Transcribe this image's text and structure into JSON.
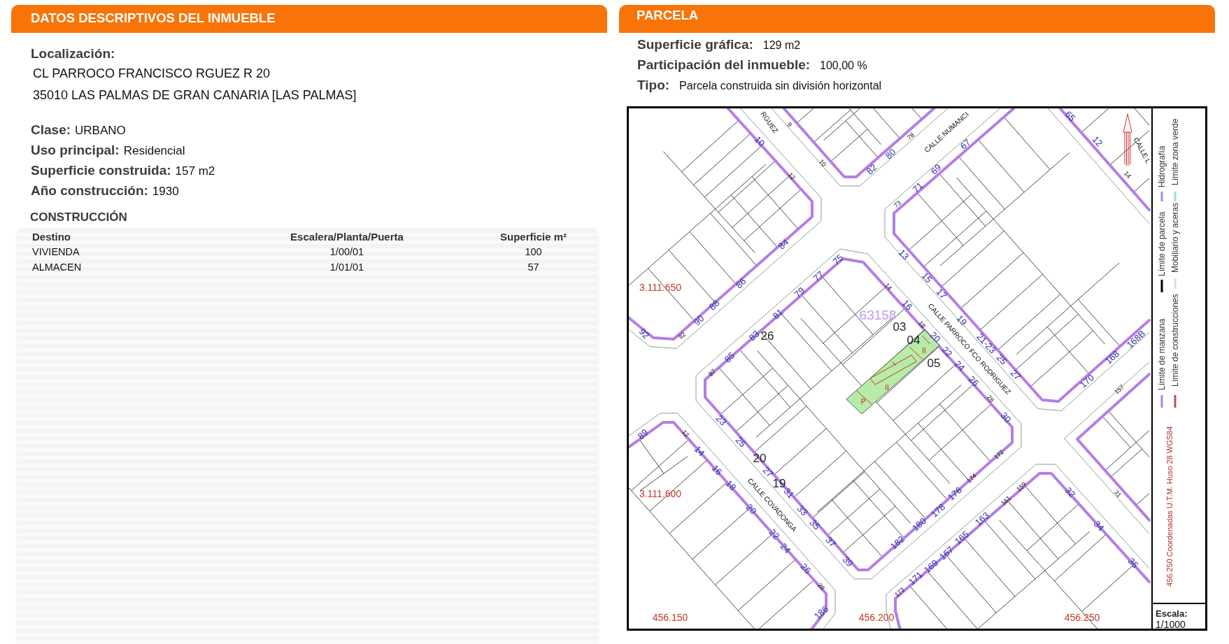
{
  "left": {
    "title": "DATOS DESCRIPTIVOS DEL INMUEBLE",
    "location": {
      "label": "Localización:",
      "lines": [
        "CL PARROCO FRANCISCO RGUEZ R 20",
        "35010 LAS PALMAS DE GRAN CANARIA [LAS PALMAS]"
      ]
    },
    "fields": [
      {
        "label": "Clase:",
        "value": "URBANO"
      },
      {
        "label": "Uso principal:",
        "value": "Residencial"
      },
      {
        "label": "Superficie construida:",
        "value": "157 m2"
      },
      {
        "label": "Año construcción:",
        "value": "1930"
      }
    ],
    "construction": {
      "title": "CONSTRUCCIÓN",
      "columns": [
        "Destino",
        "Escalera/Planta/Puerta",
        "Superficie m²"
      ],
      "rows": [
        [
          "VIVIENDA",
          "1/00/01",
          "100"
        ],
        [
          "ALMACEN",
          "1/01/01",
          "57"
        ]
      ]
    }
  },
  "parcel": {
    "title": "PARCELA",
    "fields": [
      {
        "label": "Superficie gráfica:",
        "value": "129 m2"
      },
      {
        "label": "Participación del inmueble:",
        "value": "100,00 %"
      },
      {
        "label": "Tipo:",
        "value": "Parcela construida sin división horizontal"
      }
    ],
    "map": {
      "labels": [
        {
          "text": "RGUEZ",
          "kind": "street"
        },
        {
          "text": "CALLE NUMANCI",
          "kind": "street"
        },
        {
          "text": "CALLE L",
          "kind": "street"
        },
        {
          "text": "CALLE PARROCO FCO RODRIGUEZ",
          "kind": "street"
        },
        {
          "text": "CALLE COVADONGA",
          "kind": "street"
        },
        {
          "text": "10",
          "kind": "number"
        },
        {
          "text": "84",
          "kind": "number"
        },
        {
          "text": "86",
          "kind": "number"
        },
        {
          "text": "88",
          "kind": "number"
        },
        {
          "text": "90",
          "kind": "number"
        },
        {
          "text": "92",
          "kind": "number"
        },
        {
          "text": "82",
          "kind": "number"
        },
        {
          "text": "80",
          "kind": "number"
        },
        {
          "text": "67",
          "kind": "number"
        },
        {
          "text": "69",
          "kind": "number"
        },
        {
          "text": "71",
          "kind": "number"
        },
        {
          "text": "65",
          "kind": "number"
        },
        {
          "text": "12",
          "kind": "number"
        },
        {
          "text": "13",
          "kind": "number"
        },
        {
          "text": "15",
          "kind": "number"
        },
        {
          "text": "17",
          "kind": "number"
        },
        {
          "text": "19",
          "kind": "number"
        },
        {
          "text": "21-23",
          "kind": "number"
        },
        {
          "text": "25",
          "kind": "number"
        },
        {
          "text": "27",
          "kind": "number"
        },
        {
          "text": "170",
          "kind": "number"
        },
        {
          "text": "168",
          "kind": "number"
        },
        {
          "text": "168B",
          "kind": "number"
        },
        {
          "text": "75",
          "kind": "number"
        },
        {
          "text": "77",
          "kind": "number"
        },
        {
          "text": "79",
          "kind": "number"
        },
        {
          "text": "81",
          "kind": "number"
        },
        {
          "text": "83",
          "kind": "number"
        },
        {
          "text": "85",
          "kind": "number"
        },
        {
          "text": "16",
          "kind": "number"
        },
        {
          "text": "20",
          "kind": "number"
        },
        {
          "text": "22",
          "kind": "number"
        },
        {
          "text": "24",
          "kind": "number"
        },
        {
          "text": "26",
          "kind": "number"
        },
        {
          "text": "30",
          "kind": "number"
        },
        {
          "text": "176",
          "kind": "number"
        },
        {
          "text": "178",
          "kind": "number"
        },
        {
          "text": "180",
          "kind": "number"
        },
        {
          "text": "182",
          "kind": "number"
        },
        {
          "text": "39",
          "kind": "number"
        },
        {
          "text": "37",
          "kind": "number"
        },
        {
          "text": "35",
          "kind": "number"
        },
        {
          "text": "33",
          "kind": "number"
        },
        {
          "text": "31",
          "kind": "number"
        },
        {
          "text": "27",
          "kind": "number"
        },
        {
          "text": "25",
          "kind": "number"
        },
        {
          "text": "23",
          "kind": "number"
        },
        {
          "text": "89",
          "kind": "number"
        },
        {
          "text": "14",
          "kind": "number"
        },
        {
          "text": "16",
          "kind": "number"
        },
        {
          "text": "18",
          "kind": "number"
        },
        {
          "text": "20",
          "kind": "number"
        },
        {
          "text": "22",
          "kind": "number"
        },
        {
          "text": "24",
          "kind": "number"
        },
        {
          "text": "26",
          "kind": "number"
        },
        {
          "text": "186",
          "kind": "number"
        },
        {
          "text": "171",
          "kind": "number"
        },
        {
          "text": "169",
          "kind": "number"
        },
        {
          "text": "167",
          "kind": "number"
        },
        {
          "text": "165",
          "kind": "number"
        },
        {
          "text": "163",
          "kind": "number"
        },
        {
          "text": "32",
          "kind": "number"
        },
        {
          "text": "34",
          "kind": "number"
        },
        {
          "text": "36",
          "kind": "number"
        },
        {
          "text": "9",
          "kind": "minor"
        },
        {
          "text": "12",
          "kind": "minor"
        },
        {
          "text": "10",
          "kind": "minor"
        },
        {
          "text": "78",
          "kind": "minor"
        },
        {
          "text": "73",
          "kind": "minor"
        },
        {
          "text": "14",
          "kind": "minor"
        },
        {
          "text": "92",
          "kind": "minor"
        },
        {
          "text": "87",
          "kind": "minor"
        },
        {
          "text": "14",
          "kind": "minor"
        },
        {
          "text": "18",
          "kind": "minor"
        },
        {
          "text": "157",
          "kind": "minor"
        },
        {
          "text": "28",
          "kind": "minor"
        },
        {
          "text": "172",
          "kind": "minor"
        },
        {
          "text": "174",
          "kind": "minor"
        },
        {
          "text": "12",
          "kind": "minor"
        },
        {
          "text": "28",
          "kind": "minor"
        },
        {
          "text": "173",
          "kind": "minor"
        },
        {
          "text": "161",
          "kind": "minor"
        },
        {
          "text": "159",
          "kind": "minor"
        },
        {
          "text": "31",
          "kind": "minor"
        },
        {
          "text": "26",
          "kind": "parcel"
        },
        {
          "text": "03",
          "kind": "parcel"
        },
        {
          "text": "04",
          "kind": "parcel"
        },
        {
          "text": "05",
          "kind": "parcel"
        },
        {
          "text": "20",
          "kind": "parcel"
        },
        {
          "text": "19",
          "kind": "parcel"
        },
        {
          "text": "63158",
          "kind": "ref"
        },
        {
          "text": "3.111.650",
          "kind": "coord"
        },
        {
          "text": "3.111.600",
          "kind": "coord"
        },
        {
          "text": "456.150",
          "kind": "coord"
        },
        {
          "text": "456.200",
          "kind": "coord"
        },
        {
          "text": "456.250",
          "kind": "coord"
        },
        {
          "text": "I",
          "kind": "mark"
        },
        {
          "text": "II",
          "kind": "mark"
        },
        {
          "text": "II",
          "kind": "mark"
        },
        {
          "text": "P",
          "kind": "mark"
        }
      ],
      "legend": [
        {
          "label": "Límite de manzana",
          "color": "#b47ee5"
        },
        {
          "label": "Límite de parcela",
          "color": "#000000"
        },
        {
          "label": "Hidrografía",
          "color": "#9b8ce8"
        },
        {
          "label": "Límite de construcciones",
          "color": "#c0504d"
        },
        {
          "label": "Mobiliario y aceras",
          "color": "#dddddd"
        },
        {
          "label": "Límite zona verde",
          "color": "#9fdcc4"
        }
      ],
      "crs_note": "456.250 Coordenadas U.T.M. Huso 28 WGS84",
      "scale": {
        "label": "Escala:",
        "value": "1/1000"
      }
    }
  }
}
